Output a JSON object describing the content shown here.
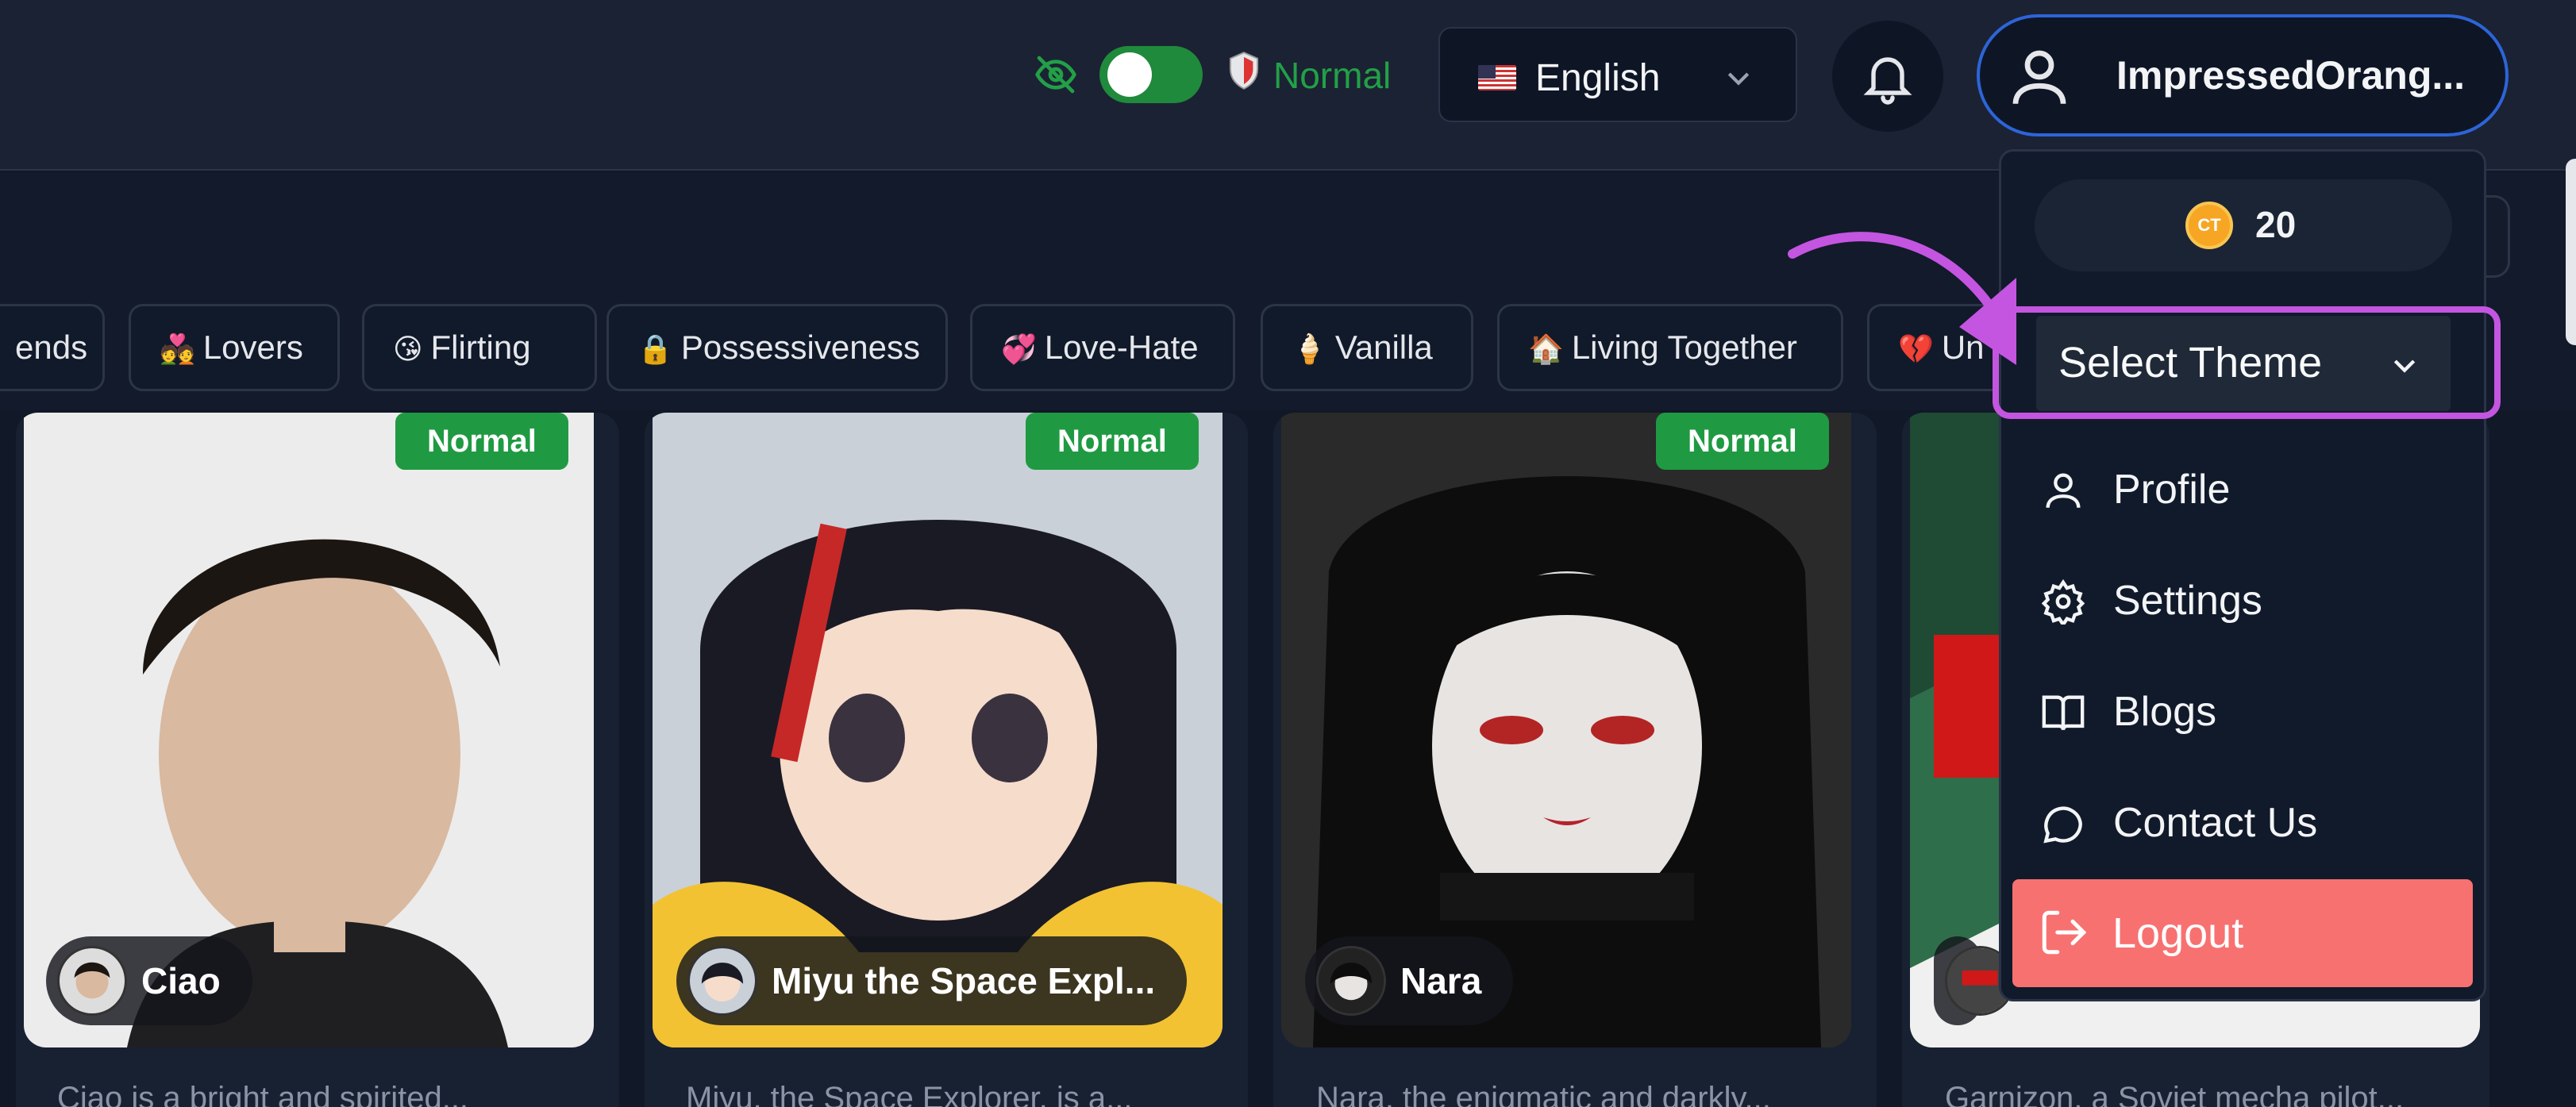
{
  "header": {
    "mode_label": "Normal",
    "language": "English",
    "username": "ImpressedOrang..."
  },
  "tags": [
    {
      "emoji": "",
      "label": "ends"
    },
    {
      "emoji": "💑",
      "label": "Lovers"
    },
    {
      "emoji": "😘",
      "label": "Flirting"
    },
    {
      "emoji": "🔒",
      "label": "Possessiveness"
    },
    {
      "emoji": "💞",
      "label": "Love-Hate"
    },
    {
      "emoji": "🍦",
      "label": "Vanilla"
    },
    {
      "emoji": "🏠",
      "label": "Living Together"
    },
    {
      "emoji": "💔",
      "label": "Un"
    }
  ],
  "cards": [
    {
      "badge": "Normal",
      "name": "Ciao",
      "desc": "Ciao is a bright and spirited..."
    },
    {
      "badge": "Normal",
      "name": "Miyu the Space Expl...",
      "desc": "Miyu, the Space Explorer, is a..."
    },
    {
      "badge": "Normal",
      "name": "Nara",
      "desc": "Nara, the enigmatic and darkly..."
    },
    {
      "badge": "",
      "name": "",
      "desc": "Garnizon, a Soviet mecha pilot..."
    }
  ],
  "menu": {
    "coins": "20",
    "coin_symbol": "CT",
    "theme_select": "Select Theme",
    "items": [
      "Profile",
      "Settings",
      "Blogs",
      "Contact Us"
    ],
    "logout": "Logout"
  },
  "colors": {
    "accent_green": "#1f9a42",
    "user_border": "#2d64d8",
    "highlight": "#c455e0",
    "logout": "#f87171"
  }
}
